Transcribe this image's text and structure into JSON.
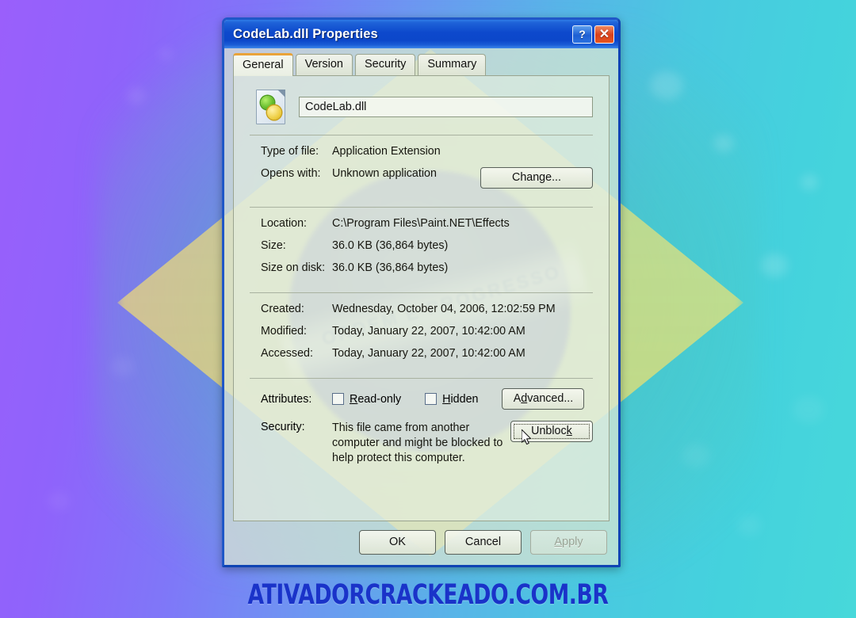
{
  "window": {
    "title": "CodeLab.dll Properties",
    "help_icon": "?",
    "close_icon": "✕"
  },
  "tabs": [
    {
      "label": "General",
      "active": true
    },
    {
      "label": "Version",
      "active": false
    },
    {
      "label": "Security",
      "active": false
    },
    {
      "label": "Summary",
      "active": false
    }
  ],
  "general": {
    "file_name": "CodeLab.dll",
    "rows": [
      {
        "label": "Type of file:",
        "value": "Application Extension"
      },
      {
        "label": "Opens with:",
        "value": "Unknown application"
      },
      {
        "label": "Location:",
        "value": "C:\\Program Files\\Paint.NET\\Effects"
      },
      {
        "label": "Size:",
        "value": "36.0 KB (36,864 bytes)"
      },
      {
        "label": "Size on disk:",
        "value": "36.0 KB (36,864 bytes)"
      },
      {
        "label": "Created:",
        "value": "Wednesday, October 04, 2006, 12:02:59 PM"
      },
      {
        "label": "Modified:",
        "value": "Today, January 22, 2007, 10:42:00 AM"
      },
      {
        "label": "Accessed:",
        "value": "Today, January 22, 2007, 10:42:00 AM"
      }
    ],
    "change_button": "Change...",
    "attributes_label": "Attributes:",
    "readonly_label": "Read-only",
    "hidden_label": "Hidden",
    "readonly_checked": false,
    "hidden_checked": false,
    "advanced_button": "Advanced...",
    "security_label": "Security:",
    "security_text": "This file came from another computer and might be blocked to help protect this computer.",
    "unblock_button": "Unblock"
  },
  "footer": {
    "ok": "OK",
    "cancel": "Cancel",
    "apply": "Apply",
    "apply_disabled": true
  },
  "watermark": {
    "text": "ATIVADORCRACKEADO.COM.BR",
    "color": "#1a33c9"
  },
  "background": {
    "flag_banner_text": "ORDEM E PROGRESSO",
    "gradient_from": "#9a5ffb",
    "gradient_to": "#47d8da"
  }
}
